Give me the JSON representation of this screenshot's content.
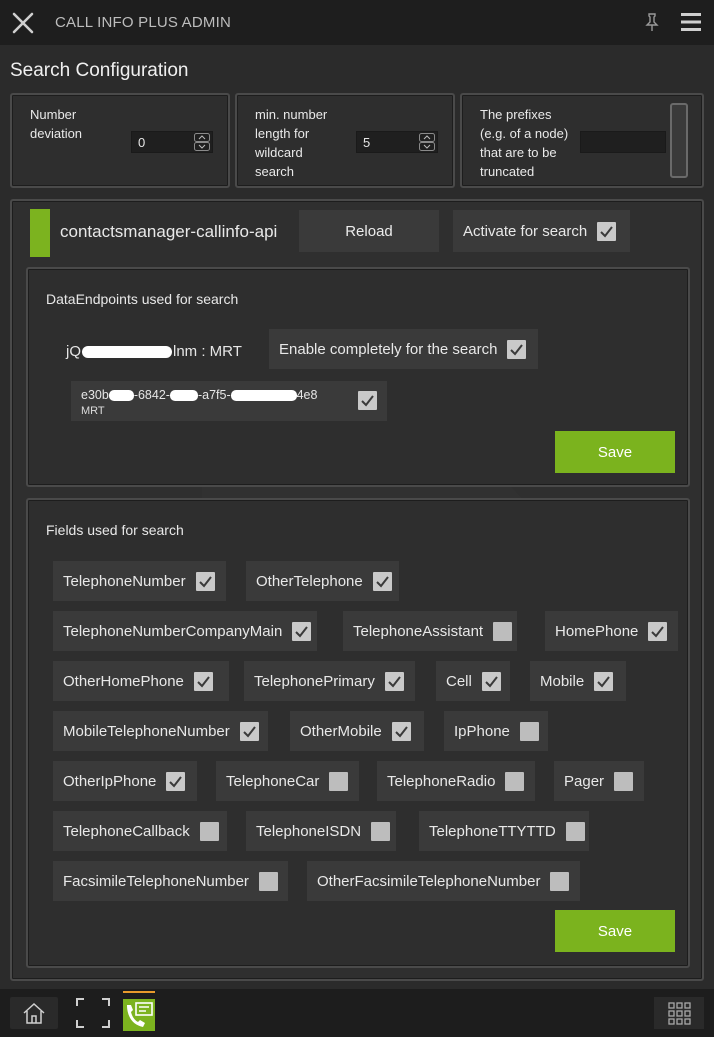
{
  "header": {
    "title": "CALL INFO PLUS ADMIN",
    "close_icon": "close-icon",
    "pin_icon": "pin-icon",
    "menu_icon": "hamburger-menu-icon"
  },
  "page": {
    "title": "Search Configuration"
  },
  "config": {
    "number_deviation": {
      "label": [
        "Number",
        "deviation"
      ],
      "value": "0"
    },
    "min_length": {
      "label": [
        "min. number",
        "length for",
        "wildcard",
        "search"
      ],
      "value": "5"
    },
    "prefixes": {
      "label": [
        "The prefixes",
        "(e.g. of a node)",
        "that are to be",
        "truncated"
      ],
      "value": ""
    }
  },
  "source": {
    "name": "contactsmanager-callinfo-api",
    "reload_label": "Reload",
    "activate_label": "Activate for search",
    "activate_checked": true,
    "status_color": "#7cb31f"
  },
  "endpoints": {
    "title": "DataEndpoints used for search",
    "endpoint_name_start": "jQ",
    "endpoint_name_end": "lnm : MRT",
    "enable_label": "Enable completely for the search",
    "enable_checked": true,
    "id_parts": [
      "e30b",
      "-6842-",
      "-a7f5-",
      "4e8"
    ],
    "id_sub": "MRT",
    "id_checked": true,
    "save_label": "Save"
  },
  "fields": {
    "title": "Fields used for search",
    "items": [
      {
        "label": "TelephoneNumber",
        "checked": true
      },
      {
        "label": "OtherTelephone",
        "checked": true
      },
      {
        "label": "TelephoneNumberCompanyMain",
        "checked": true
      },
      {
        "label": "TelephoneAssistant",
        "checked": false
      },
      {
        "label": "HomePhone",
        "checked": true
      },
      {
        "label": "OtherHomePhone",
        "checked": true
      },
      {
        "label": "TelephonePrimary",
        "checked": true
      },
      {
        "label": "Cell",
        "checked": true
      },
      {
        "label": "Mobile",
        "checked": true
      },
      {
        "label": "MobileTelephoneNumber",
        "checked": true
      },
      {
        "label": "OtherMobile",
        "checked": true
      },
      {
        "label": "IpPhone",
        "checked": false
      },
      {
        "label": "OtherIpPhone",
        "checked": true
      },
      {
        "label": "TelephoneCar",
        "checked": false
      },
      {
        "label": "TelephoneRadio",
        "checked": false
      },
      {
        "label": "Pager",
        "checked": false
      },
      {
        "label": "TelephoneCallback",
        "checked": false
      },
      {
        "label": "TelephoneISDN",
        "checked": false
      },
      {
        "label": "TelephoneTTYTTD",
        "checked": false
      },
      {
        "label": "FacsimileTelephoneNumber",
        "checked": false
      },
      {
        "label": "OtherFacsimileTelephoneNumber",
        "checked": false
      }
    ],
    "save_label": "Save"
  },
  "footer": {
    "home_icon": "home-icon",
    "fullscreen_icon": "fullscreen-icon",
    "app_icon": "callinfo-app-icon",
    "grid_icon": "grid-icon",
    "accent": "#7cb31f"
  }
}
